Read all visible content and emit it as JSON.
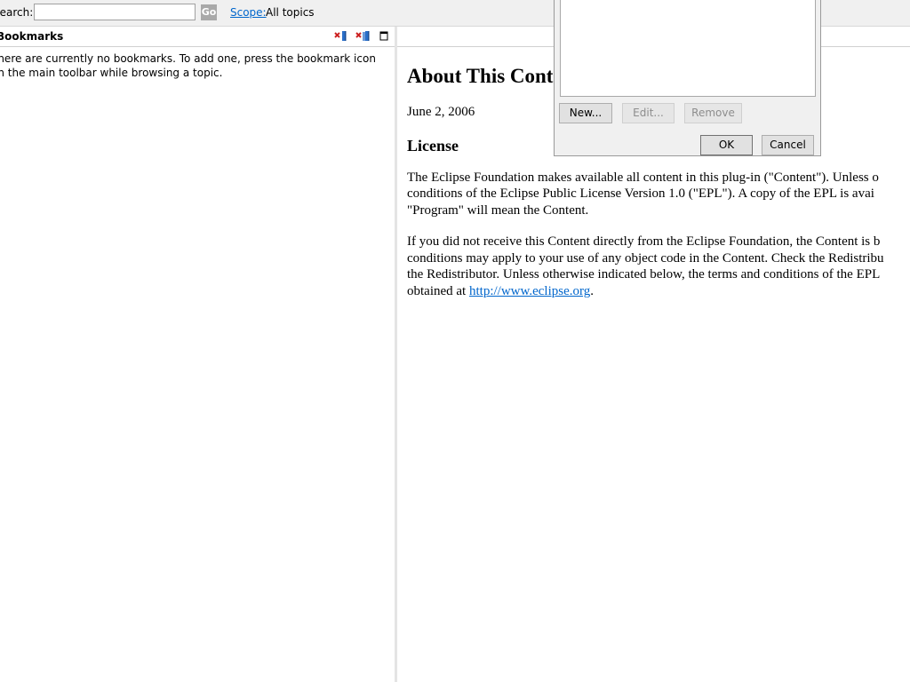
{
  "searchbar": {
    "label": "Search:",
    "input_value": "",
    "go_label": "Go",
    "scope_link": "Scope:",
    "scope_value": "All topics"
  },
  "bookmarks": {
    "title": "Bookmarks",
    "empty_message": "There are currently no bookmarks. To add one, press the bookmark icon on the main toolbar while browsing a topic.",
    "icons": [
      "remove-bookmark-icon",
      "remove-all-bookmarks-icon",
      "maximize-icon"
    ]
  },
  "content": {
    "title": "About This Content",
    "date": "June 2, 2006",
    "license_heading": "License",
    "para1_lines": [
      "The Eclipse Foundation makes available all content in this plug-in (\"Content\"). Unless o",
      "conditions of the Eclipse Public License Version 1.0 (\"EPL\"). A copy of the EPL is avai",
      "\"Program\" will mean the Content."
    ],
    "para2_lines": [
      "If you did not receive this Content directly from the Eclipse Foundation, the Content is b",
      "conditions may apply to your use of any object code in the Content. Check the Redistribu",
      "the Redistributor. Unless otherwise indicated below, the terms and conditions of the EPL"
    ],
    "para2_last_prefix": "obtained at ",
    "link": "http://www.eclipse.org",
    "para2_last_suffix": "."
  },
  "dialog": {
    "new_label": "New...",
    "edit_label": "Edit...",
    "remove_label": "Remove",
    "ok_label": "OK",
    "cancel_label": "Cancel"
  },
  "colors": {
    "link": "#0066cc",
    "toolbar_bg": "#f0f0f0",
    "icon_red": "#cc2222",
    "icon_blue": "#2a6fc9"
  }
}
